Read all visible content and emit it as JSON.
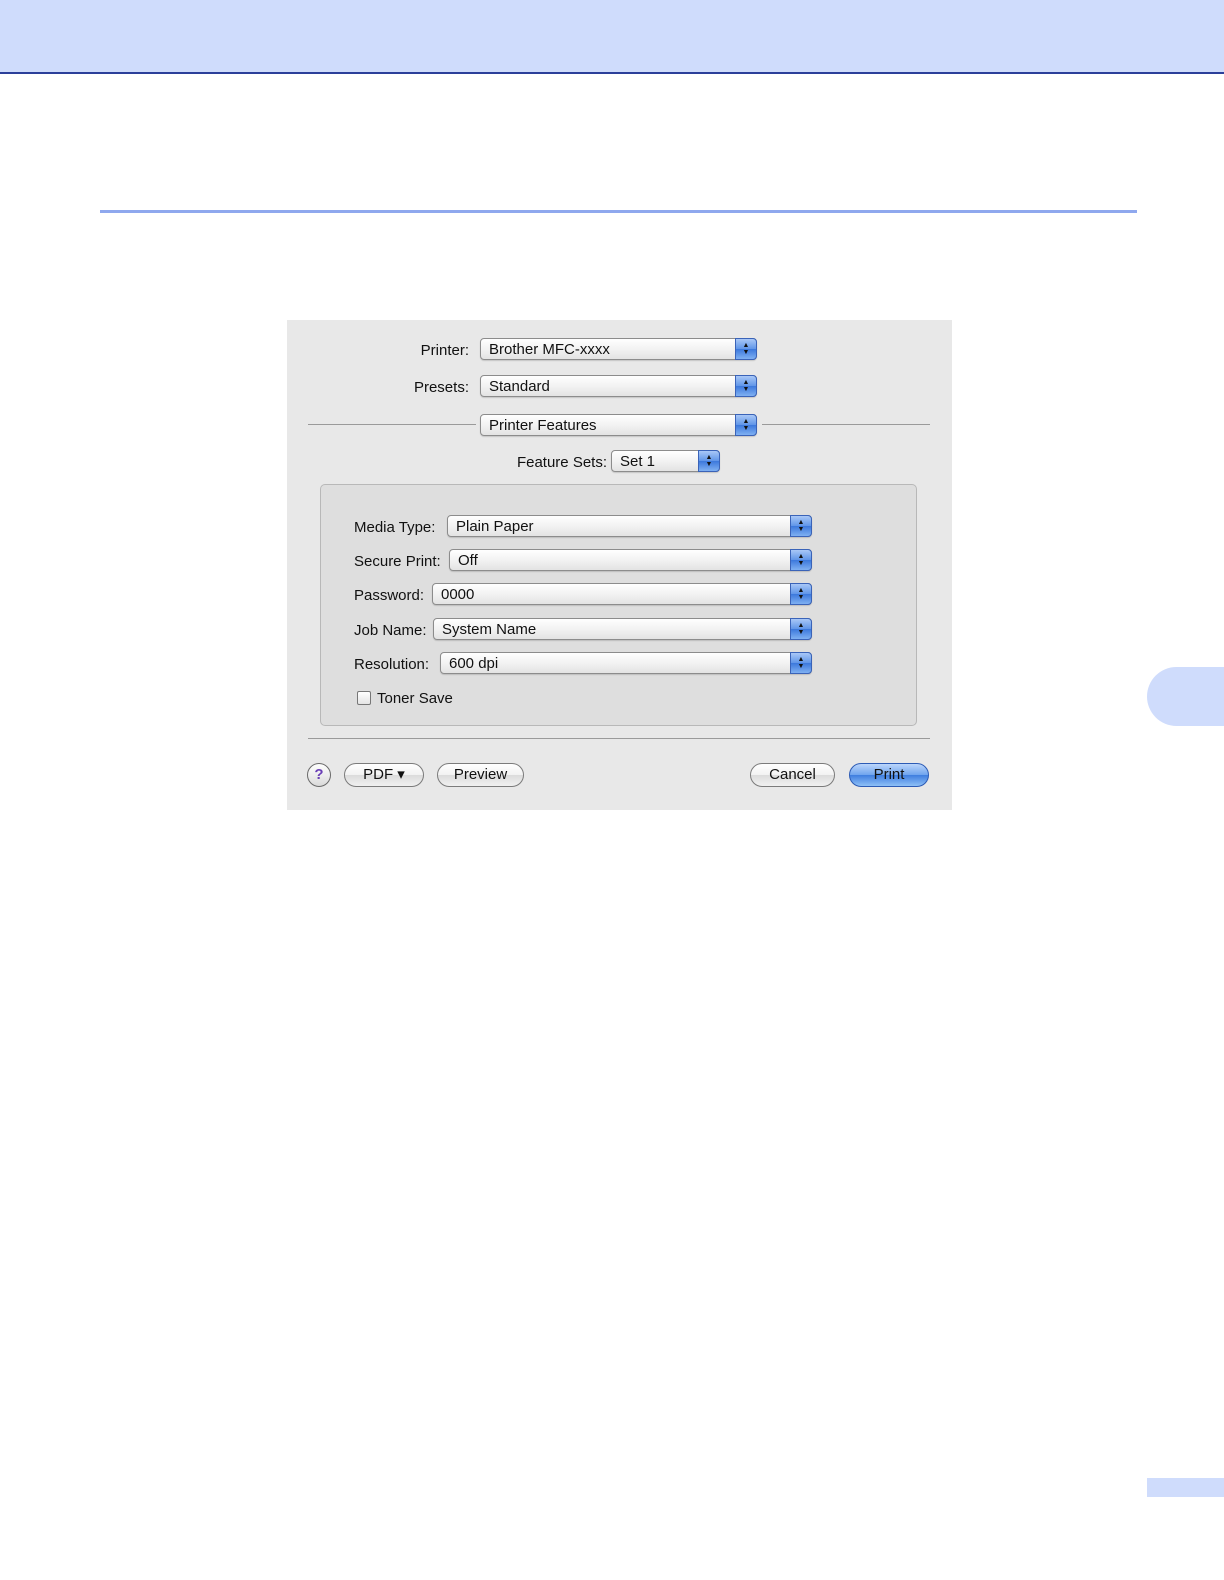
{
  "dialog": {
    "printer": {
      "label": "Printer:",
      "value": "Brother MFC-xxxx"
    },
    "presets": {
      "label": "Presets:",
      "value": "Standard"
    },
    "pane": {
      "value": "Printer Features"
    },
    "feature_sets": {
      "label": "Feature Sets:",
      "value": "Set 1"
    },
    "options": [
      {
        "label": "Media Type:",
        "value": "Plain Paper"
      },
      {
        "label": "Secure Print:",
        "value": "Off"
      },
      {
        "label": "Password:",
        "value": "0000"
      },
      {
        "label": "Job Name:",
        "value": "System Name"
      },
      {
        "label": "Resolution:",
        "value": "600 dpi"
      }
    ],
    "toner_save": {
      "label": "Toner Save",
      "checked": false
    },
    "buttons": {
      "help": "?",
      "pdf": "PDF ▾",
      "preview": "Preview",
      "cancel": "Cancel",
      "print": "Print"
    }
  },
  "icons": {
    "popup_arrows": "updown-arrows-icon",
    "help": "question-icon"
  },
  "colors": {
    "band": "#cfdcfc",
    "band_border": "#2b3f9a",
    "accent_rule": "#8fa8ee",
    "default_button": "#3f7ee0"
  }
}
